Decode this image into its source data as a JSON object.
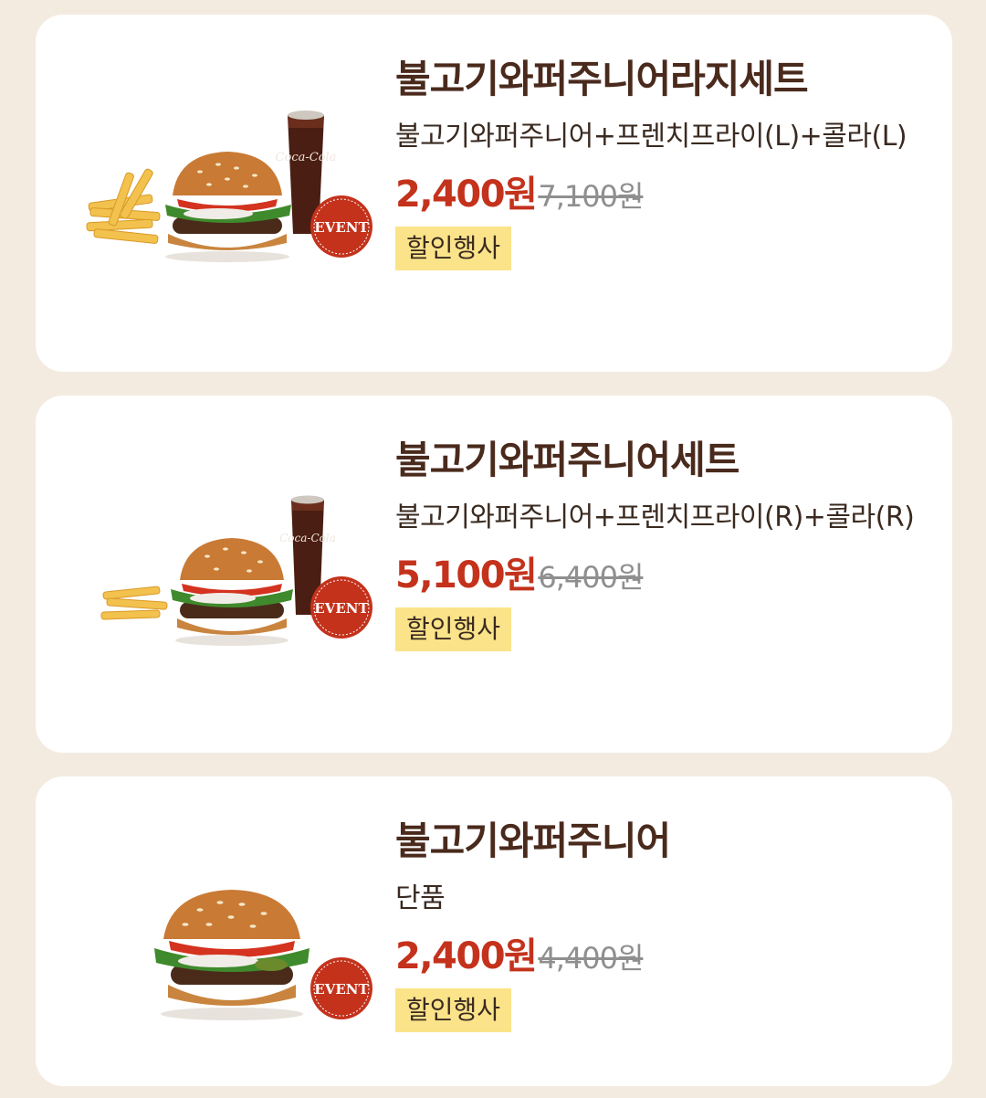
{
  "menu_items": [
    {
      "title": "불고기와퍼주니어라지세트",
      "description": "불고기와퍼주니어+프렌치프라이(L)+콜라(L)",
      "price": "2,400원",
      "original_price": "7,100원",
      "badge": "할인행사",
      "image_badge": "EVENT",
      "image_icon": "burger-set-large-icon"
    },
    {
      "title": "불고기와퍼주니어세트",
      "description": "불고기와퍼주니어+프렌치프라이(R)+콜라(R)",
      "price": "5,100원",
      "original_price": "6,400원",
      "badge": "할인행사",
      "image_badge": "EVENT",
      "image_icon": "burger-set-icon"
    },
    {
      "title": "불고기와퍼주니어",
      "description": "단품",
      "price": "2,400원",
      "original_price": "4,400원",
      "badge": "할인행사",
      "image_badge": "EVENT",
      "image_icon": "burger-icon"
    }
  ],
  "colors": {
    "background": "#f4ebe0",
    "card": "#ffffff",
    "title": "#4a2a1c",
    "price": "#c4321c",
    "original_price": "#8f8f8f",
    "badge_bg": "#fbe38a",
    "event_badge": "#c4321c"
  }
}
